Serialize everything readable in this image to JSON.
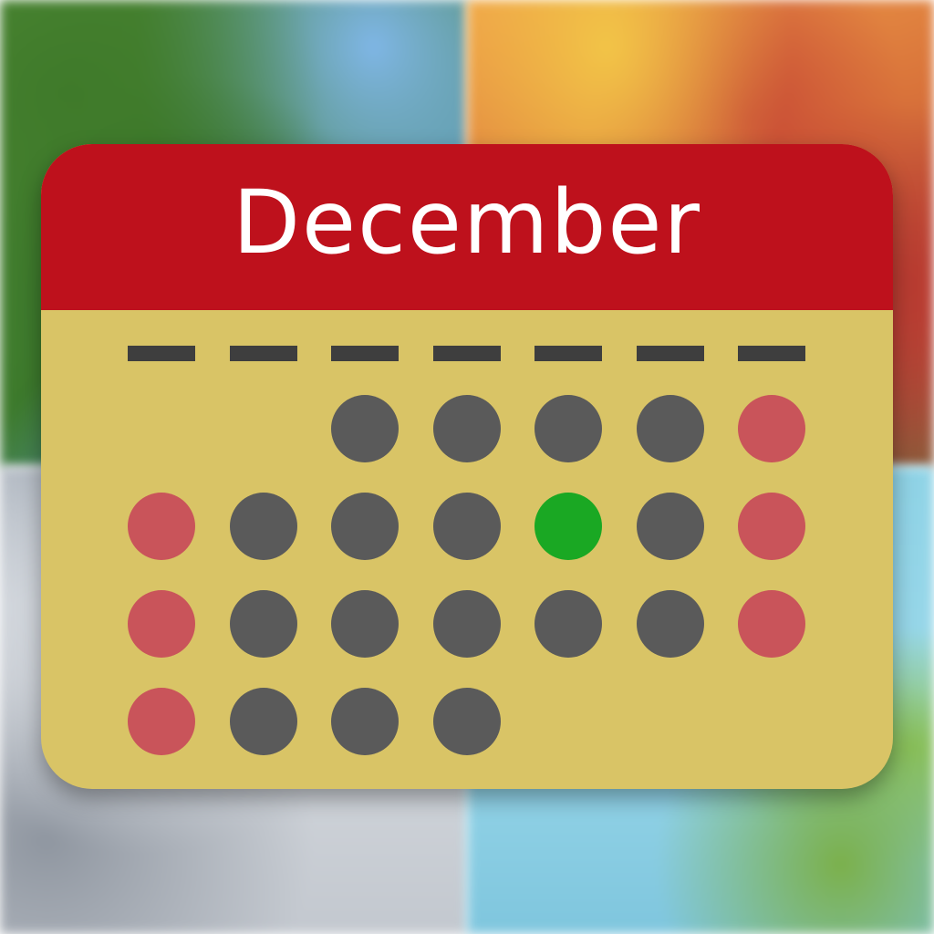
{
  "background": {
    "quadrants": [
      "summer",
      "autumn",
      "winter",
      "spring"
    ]
  },
  "calendar": {
    "month": "December",
    "colors": {
      "header": "#be111c",
      "body": "#d9c466",
      "weekday_bar": "#3e3e3e",
      "weekday_dot": "#5a5a5a",
      "weekend_dot": "#c9545a",
      "today_dot": "#1aa823"
    },
    "weekday_headers": [
      "",
      "",
      "",
      "",
      "",
      "",
      ""
    ],
    "weeks": [
      [
        null,
        null,
        "weekday",
        "weekday",
        "weekday",
        "weekday",
        "weekend"
      ],
      [
        "weekend",
        "weekday",
        "weekday",
        "weekday",
        "today",
        "weekday",
        "weekend"
      ],
      [
        "weekend",
        "weekday",
        "weekday",
        "weekday",
        "weekday",
        "weekday",
        "weekend"
      ],
      [
        "weekend",
        "weekday",
        "weekday",
        "weekday",
        null,
        null,
        null
      ]
    ]
  }
}
